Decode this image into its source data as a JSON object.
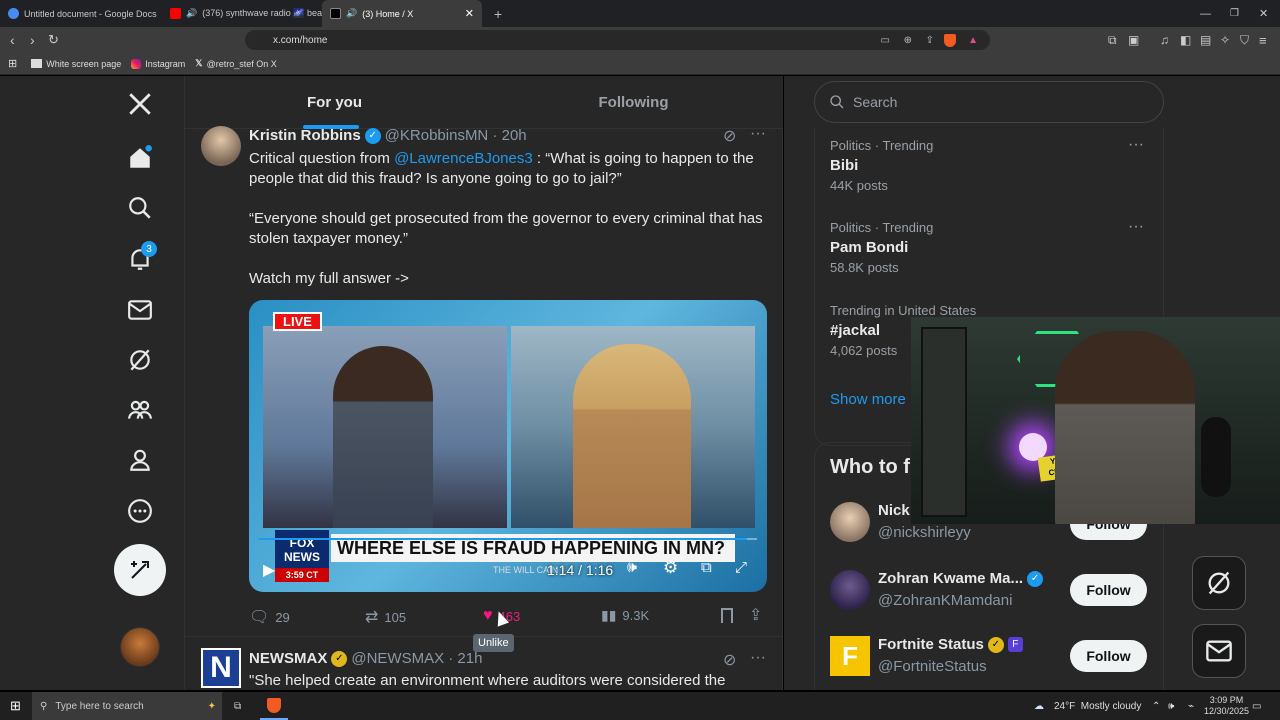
{
  "browser": {
    "tabs": [
      {
        "label": "Untitled document - Google Docs",
        "color": "#4285f4"
      },
      {
        "label": "(376) synthwave radio 🌌 beats t",
        "color": "#ff0000"
      },
      {
        "label": "(3) Home / X",
        "color": "#000000"
      }
    ],
    "url": "x.com/home",
    "bookmarks": [
      "White screen page",
      "Instagram",
      "@retro_stef On X"
    ]
  },
  "nav": {
    "notification_count": "3",
    "icons": [
      "home-icon",
      "search-icon",
      "bell-icon",
      "mail-icon",
      "grok-icon",
      "communities-icon",
      "profile-icon",
      "more-icon"
    ]
  },
  "timeline": {
    "tabs": [
      "For you",
      "Following"
    ],
    "post1": {
      "author": "Kristin Robbins",
      "handle": "@KRobbinsMN · 20h",
      "text_prefix": "Critical question from ",
      "mention": "@LawrenceBJones3",
      "text_suffix": " : “What is going to happen to the people that did this fraud? Is anyone going to go to jail?”",
      "para2": "“Everyone should get prosecuted from the governor to every criminal that has stolen taxpayer money.”",
      "para3": "Watch my full answer ->",
      "video": {
        "live_label": "LIVE",
        "chyron": "WHERE ELSE IS FRAUD HAPPENING IN MN?",
        "network": "FOX NEWS",
        "time_badge": "3:59 CT",
        "show_tag": "THE WILL CAIN",
        "time": "1:14 / 1:16",
        "progress": 0.98
      },
      "replies": "29",
      "reposts": "105",
      "likes": "463",
      "views": "9.3K",
      "tooltip": "Unlike"
    },
    "post2": {
      "author": "NEWSMAX",
      "handle": "@NEWSMAX · 21h",
      "text": "\"She helped create an environment where auditors were considered the"
    }
  },
  "sidebar": {
    "search_placeholder": "Search",
    "trends": [
      {
        "context": "Politics · Trending",
        "name": "Bibi",
        "count": "44K posts"
      },
      {
        "context": "Politics · Trending",
        "name": "Pam Bondi",
        "count": "58.8K posts"
      },
      {
        "context": "Trending in United States",
        "name": "#jackal",
        "count": "4,062 posts"
      }
    ],
    "show_more": "Show more",
    "who_to_follow": "Who to f",
    "suggestions": [
      {
        "name": "Nick",
        "handle": "@nickshirleyy",
        "button": "Follow"
      },
      {
        "name": "Zohran Kwame Ma...",
        "handle": "@ZohranKMamdani",
        "button": "Follow"
      },
      {
        "name": "Fortnite Status",
        "handle": "@FortniteStatus",
        "button": "Follow"
      }
    ]
  },
  "webcam": {
    "sign_text": "YES CERS"
  },
  "taskbar": {
    "search_placeholder": "Type here to search",
    "weather": "24°F  Mostly cloudy",
    "time": "3:09 PM",
    "date": "12/30/2025"
  },
  "colors": {
    "accent": "#1d9bf0",
    "like": "#f91880",
    "verified_gold": "#e2b719"
  }
}
